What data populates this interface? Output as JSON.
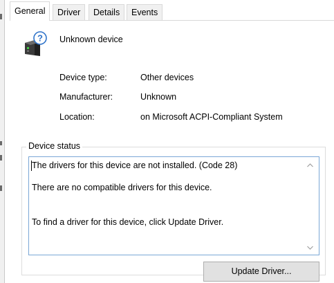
{
  "tabs": [
    {
      "label": "General",
      "active": true
    },
    {
      "label": "Driver",
      "active": false
    },
    {
      "label": "Details",
      "active": false
    },
    {
      "label": "Events",
      "active": false
    }
  ],
  "device": {
    "name": "Unknown device",
    "icon": "unknown-device-icon"
  },
  "properties": {
    "device_type": {
      "label": "Device type:",
      "value": "Other devices"
    },
    "manufacturer": {
      "label": "Manufacturer:",
      "value": "Unknown"
    },
    "location": {
      "label": "Location:",
      "value": "on Microsoft ACPI-Compliant System"
    }
  },
  "device_status": {
    "legend": "Device status",
    "lines": [
      "The drivers for this device are not installed. (Code 28)",
      "There are no compatible drivers for this device.",
      "To find a driver for this device, click Update Driver."
    ]
  },
  "buttons": {
    "update_driver": "Update Driver..."
  },
  "colors": {
    "status_box_border": "#7aa7d6",
    "button_bg": "#e1e1e1",
    "icon_badge": "#2f73c9"
  }
}
